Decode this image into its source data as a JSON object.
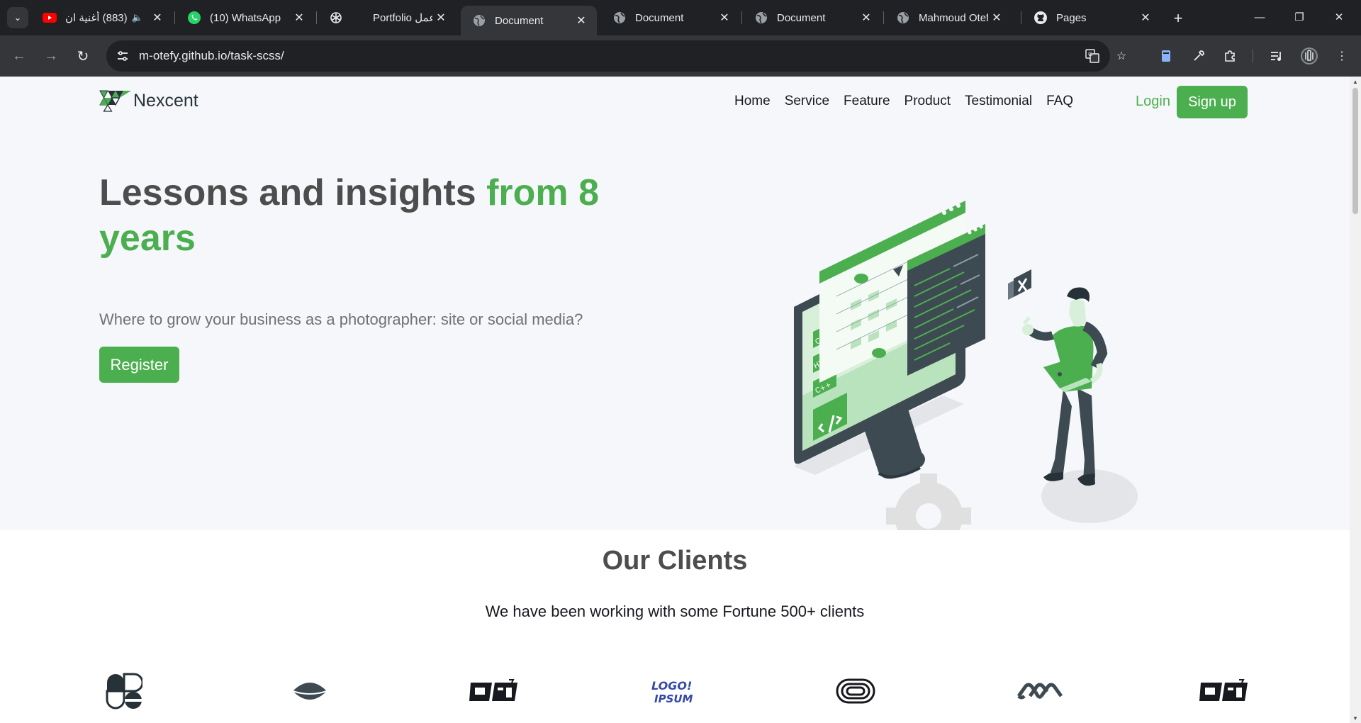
{
  "browser": {
    "tabs": [
      {
        "title": "(883) أغنية ان",
        "icon": "youtube-icon",
        "audio": true
      },
      {
        "title": "(10) WhatsApp",
        "icon": "whatsapp-icon"
      },
      {
        "title": "Portfolio عمل",
        "icon": "openai-icon"
      },
      {
        "title": "Document",
        "icon": "globe-icon",
        "active": true
      },
      {
        "title": "Document",
        "icon": "globe-icon"
      },
      {
        "title": "Document",
        "icon": "globe-icon"
      },
      {
        "title": "Mahmoud Otefy",
        "icon": "globe-icon"
      },
      {
        "title": "Pages",
        "icon": "github-icon"
      }
    ],
    "url_host": "m-otefy.github.io",
    "url_path": "/task-scss/"
  },
  "page": {
    "brand": "Nexcent",
    "nav": [
      "Home",
      "Service",
      "Feature",
      "Product",
      "Testimonial",
      "FAQ"
    ],
    "login": "Login",
    "signup": "Sign up",
    "hero_title_a": "Lessons and insights ",
    "hero_title_b": "from 8 years",
    "hero_subtitle": "Where to grow your business as a photographer: site or social media?",
    "register": "Register",
    "clients_title": "Our Clients",
    "clients_subtitle": "We have been working with some Fortune 500+ clients",
    "illustration_labels": [
      "CSS",
      "HTML",
      "C++"
    ],
    "colors": {
      "primary": "#4CAF4F",
      "dark": "#4D4D4D",
      "hero_bg": "#F5F7FA"
    }
  }
}
